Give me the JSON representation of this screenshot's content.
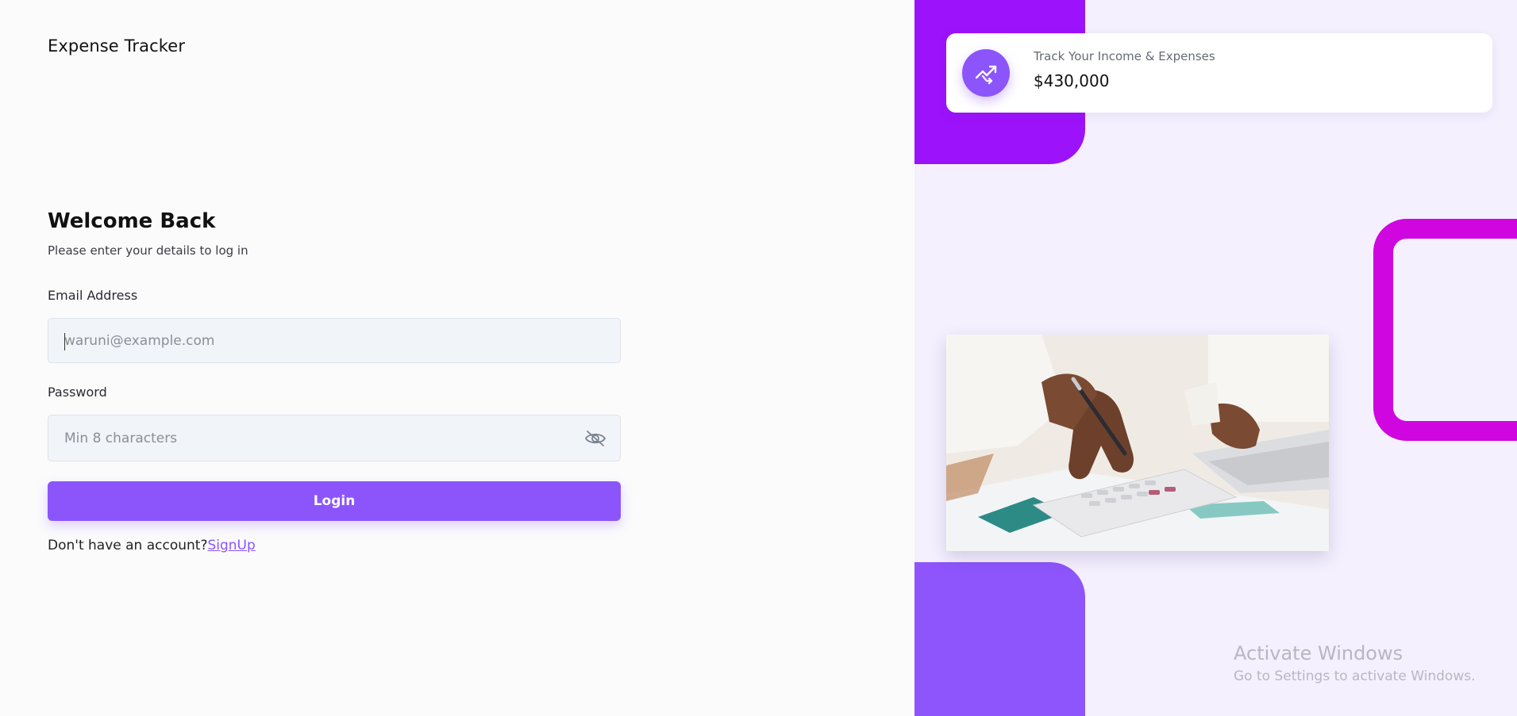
{
  "app": {
    "title": "Expense Tracker"
  },
  "login": {
    "title": "Welcome Back",
    "subtitle": "Please enter your details to log in",
    "email_label": "Email Address",
    "email_placeholder": "waruni@example.com",
    "password_label": "Password",
    "password_placeholder": "Min 8 characters",
    "login_button": "Login",
    "no_account_text": "Don't have an account?",
    "signup_link": "SignUp"
  },
  "stat_card": {
    "icon": "trend-icon",
    "label": "Track Your Income & Expenses",
    "value": "$430,000"
  },
  "image": {
    "description_icon": "calculator-photo"
  },
  "windows_watermark": {
    "line1": "Activate Windows",
    "line2": "Go to Settings to activate Windows."
  },
  "colors": {
    "accent": "#8b55fb",
    "purple_dark": "#9c12fa",
    "magenta": "#cf06df",
    "panel_bg": "#f4f0fe"
  }
}
